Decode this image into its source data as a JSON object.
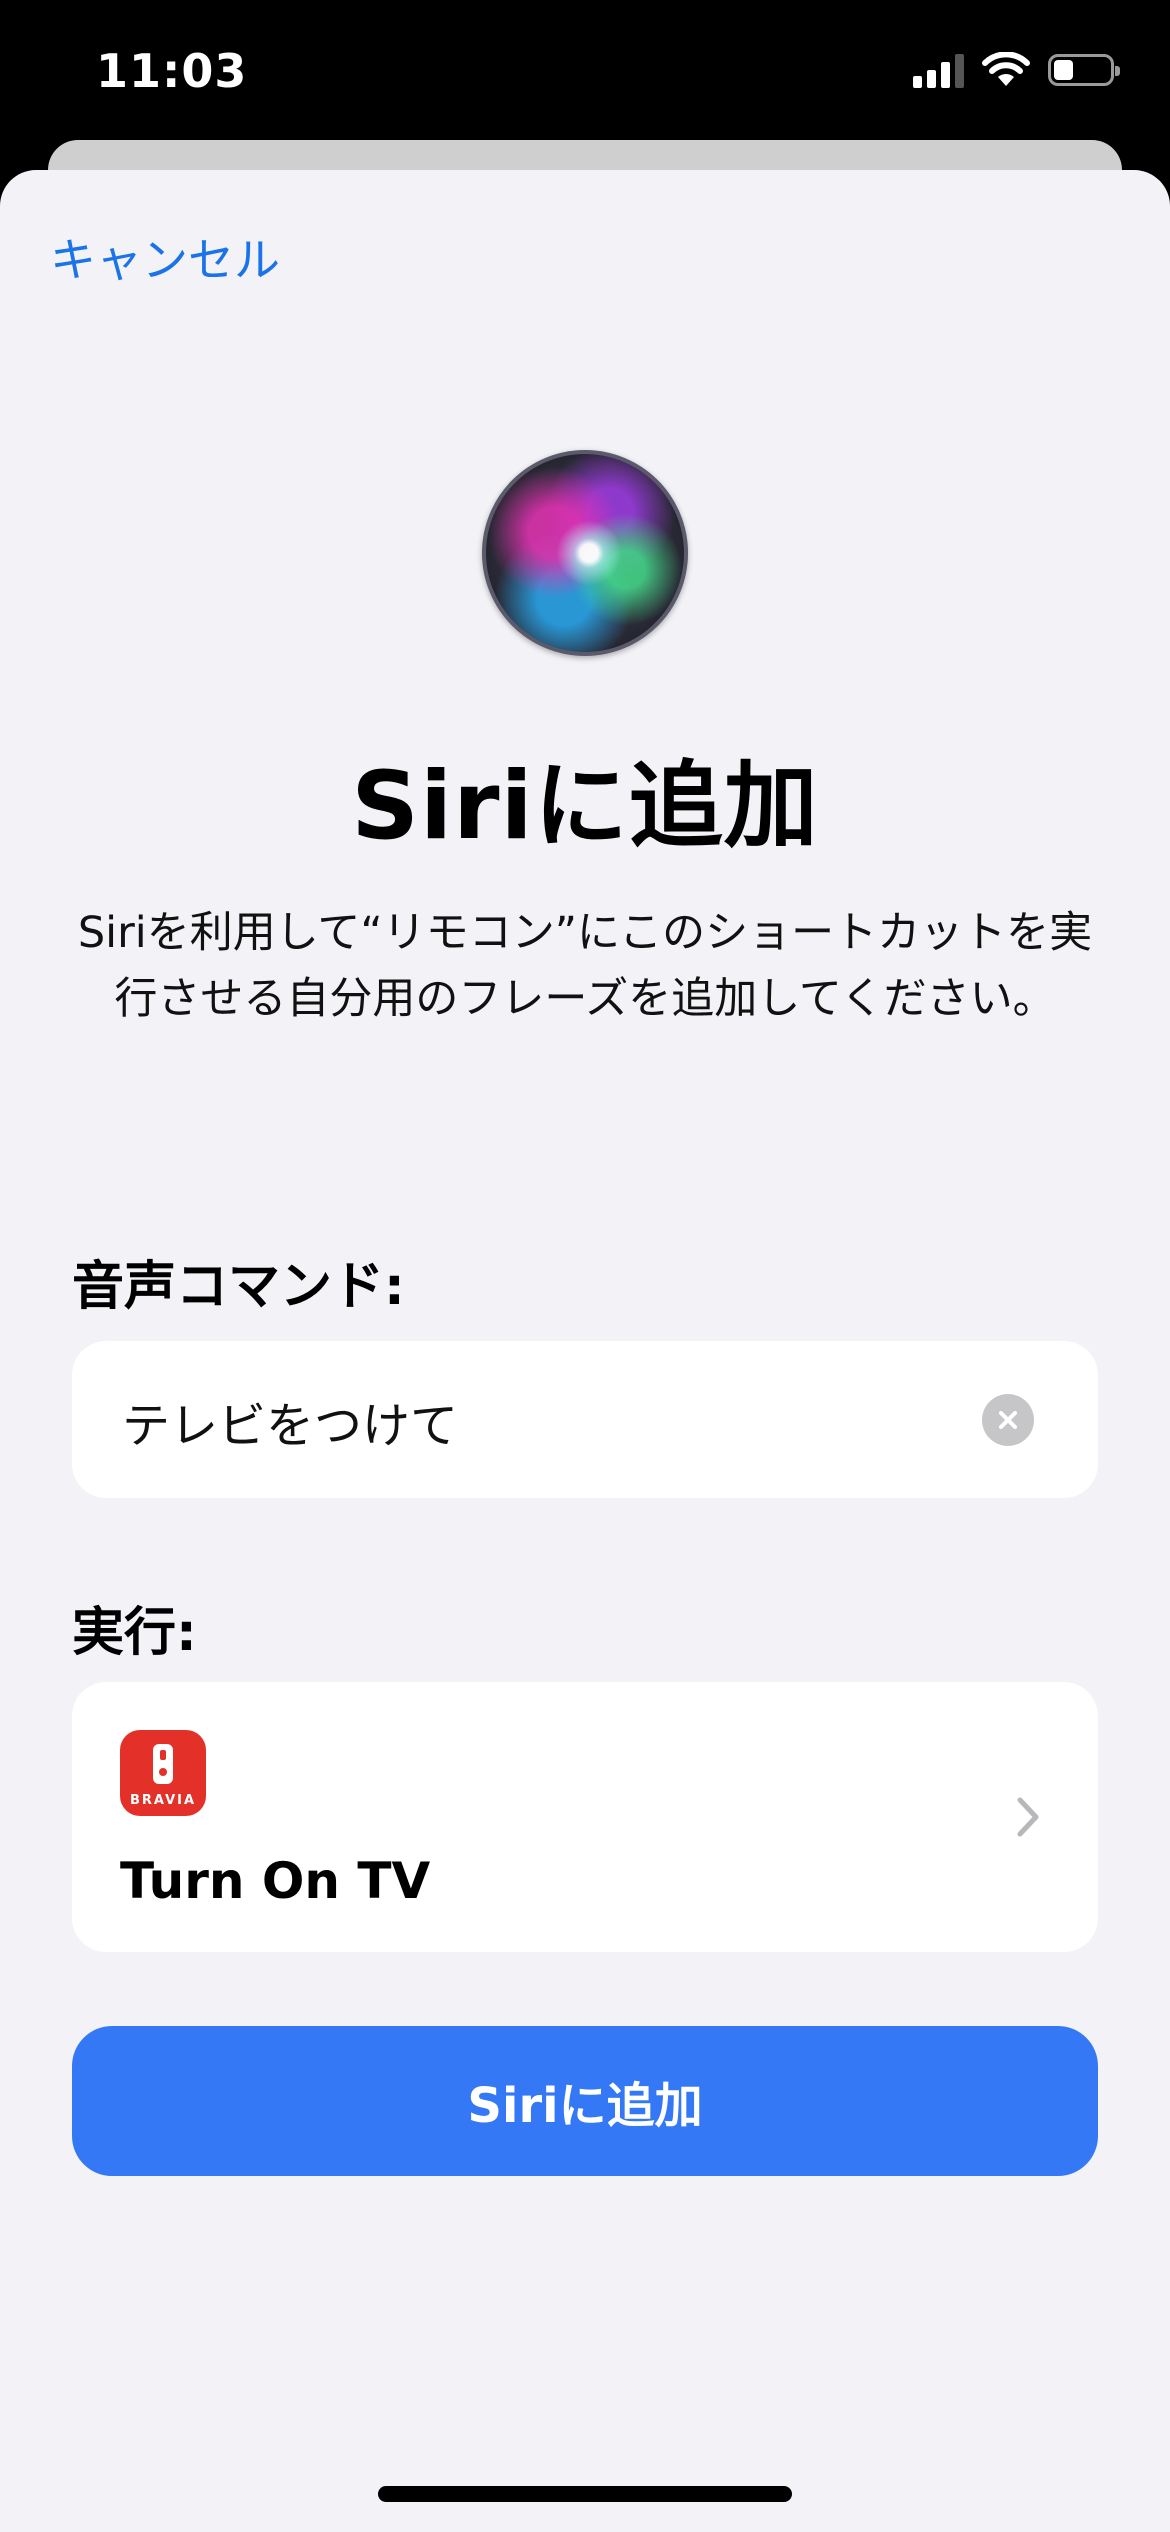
{
  "status_bar": {
    "time": "11:03",
    "icons": [
      "cellular-signal-icon",
      "wifi-icon",
      "battery-icon"
    ],
    "battery_level": 0.35
  },
  "sheet": {
    "cancel_label": "キャンセル",
    "siri_icon": "siri-orb-icon",
    "title": "Siriに追加",
    "description": "Siriを利用して“リモコン”にこのショートカットを実行させる自分用のフレーズを追加してください。",
    "voice_command": {
      "label": "音声コマンド:",
      "value": "テレビをつけて",
      "clear_icon": "clear-circle-icon"
    },
    "run": {
      "label": "実行:",
      "app_icon": "bravia-remote-app-icon",
      "app_icon_text": "BRAVIA",
      "action_title": "Turn On TV",
      "chevron_icon": "chevron-right-icon"
    },
    "primary_button": "Siriに追加"
  },
  "colors": {
    "accent": "#3478f6",
    "link": "#1a73e8",
    "background": "#f2f2f7",
    "app_icon": "#e3312a"
  }
}
